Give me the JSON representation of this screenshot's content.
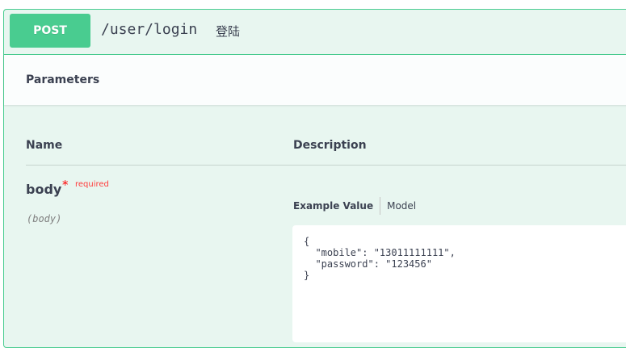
{
  "operation": {
    "method": "POST",
    "path": "/user/login",
    "description": "登陆",
    "method_color": "#49cc90"
  },
  "parameters_section": {
    "title": "Parameters",
    "columns": {
      "name": "Name",
      "description": "Description"
    }
  },
  "parameter": {
    "name": "body",
    "required_star": "*",
    "required_label": "required",
    "in": "(body)"
  },
  "example_tabs": {
    "active": "Example Value",
    "model": "Model"
  },
  "example_code": "{\n  \"mobile\": \"13011111111\",\n  \"password\": \"123456\"\n}"
}
